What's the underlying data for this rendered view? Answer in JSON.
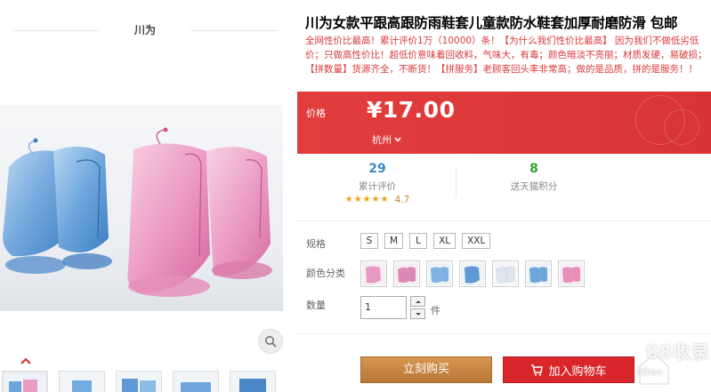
{
  "shop": {
    "name": "川为"
  },
  "product": {
    "title": "川为女款平跟高跟防雨鞋套儿童款防水鞋套加厚耐磨防滑 包邮",
    "subtitle": "全网性价比最高！累计评价1万（10000）条！【为什么我们性价比最高】 因为我们不做低劣低价；只做高性价比！超低价意味着回收料，气味大，有毒；颜色暗淡不亮丽；材质发硬，易破损；【拼数量】货源齐全，不断货！【拼服务】老顾客回头率非常高；做的是品质，拼的是服务！！"
  },
  "price": {
    "label": "价格",
    "value": "¥17.00",
    "location": "杭州"
  },
  "stats": {
    "sales_count": "29",
    "sales_label": "累计评价",
    "rating": "4.7",
    "rating_stars": 5,
    "points": "8",
    "points_label": "送天猫积分"
  },
  "options": {
    "size_label": "规格",
    "sizes": [
      "S",
      "M",
      "L",
      "XL",
      "XXL"
    ],
    "color_label": "颜色分类",
    "colors": [
      {
        "icon": "pink-shoe-cover-swatch",
        "color": "#e79ac1"
      },
      {
        "icon": "pink-shoe-cover-swatch",
        "color": "#d98bb5"
      },
      {
        "icon": "blue-shoe-cover-swatch",
        "color": "#7fb1e2"
      },
      {
        "icon": "blue-shoe-cover-swatch",
        "color": "#5f9ad6"
      },
      {
        "icon": "white-shoe-cover-swatch",
        "color": "#dfe6ee"
      },
      {
        "icon": "blue-shoe-cover-swatch",
        "color": "#6ea5dc"
      },
      {
        "icon": "pink-shoe-cover-swatch",
        "color": "#e58fb9"
      }
    ],
    "qty_label": "数量",
    "qty_value": "1",
    "qty_unit": "件"
  },
  "actions": {
    "buy_now": "立刻购买",
    "add_to_cart": "加入购物车"
  },
  "watermark": {
    "text": "08收录",
    "sub": "08wo"
  },
  "colors": {
    "price_bg": "#e4393c",
    "buy_btn": "#c48642",
    "cart_btn": "#d8262a",
    "sales_num": "#3b88c3",
    "points_num": "#31a12e"
  }
}
